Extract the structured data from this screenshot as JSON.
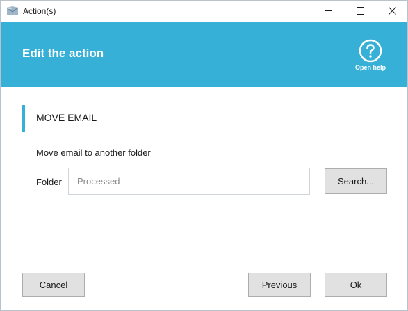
{
  "window": {
    "title": "Action(s)",
    "app_icon": "mail-envelope-icon",
    "controls": [
      "minimize-icon",
      "maximize-icon",
      "close-icon"
    ]
  },
  "header": {
    "title": "Edit the action",
    "help_label": "Open help",
    "help_icon": "question-circle-icon",
    "background_color": "#36b0d6"
  },
  "section": {
    "title": "MOVE EMAIL",
    "accent_color": "#36b0d6"
  },
  "form": {
    "description": "Move email to another folder",
    "folder_label": "Folder",
    "folder_placeholder": "Processed",
    "folder_value": "",
    "search_label": "Search..."
  },
  "footer": {
    "cancel_label": "Cancel",
    "previous_label": "Previous",
    "ok_label": "Ok"
  }
}
